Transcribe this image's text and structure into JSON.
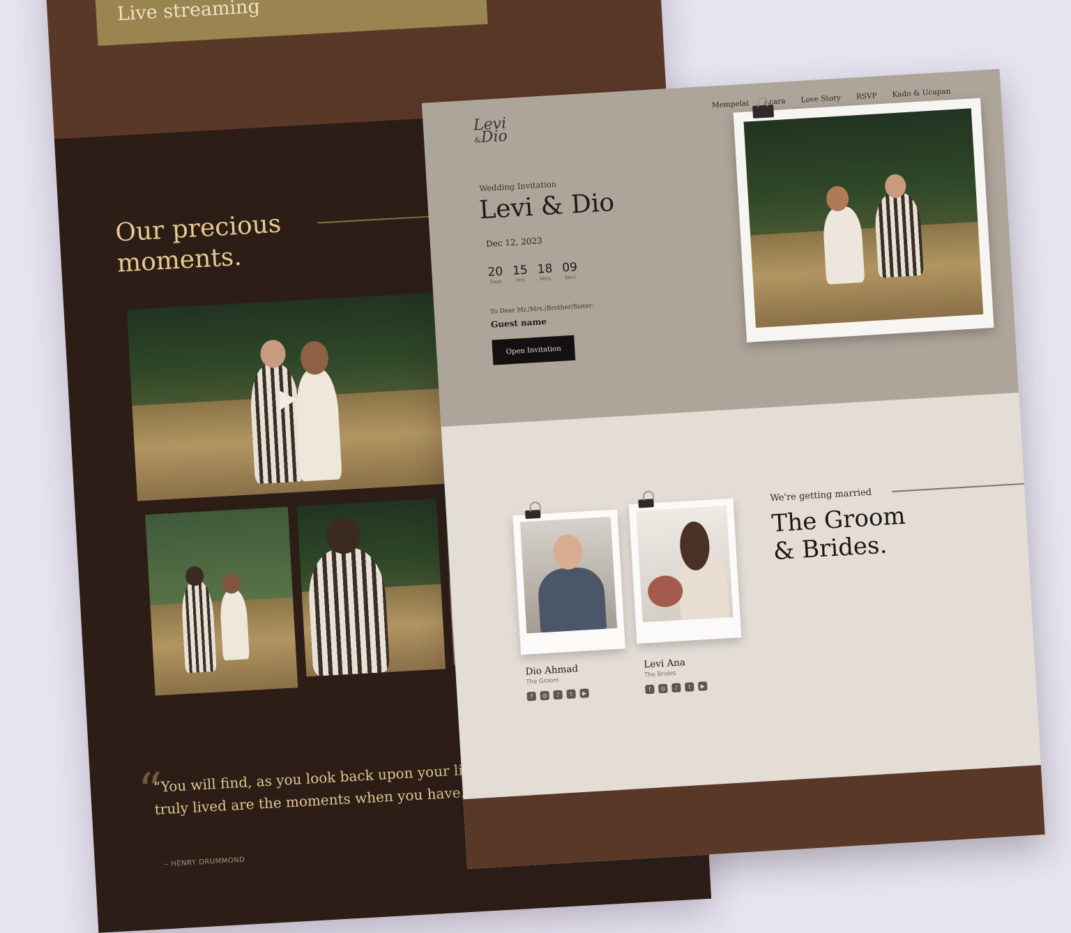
{
  "back_page": {
    "live_streaming_label": "Live streaming",
    "moments_title_line1": "Our precious",
    "moments_title_line2": "moments.",
    "quote_text": "“You will find, as you look back upon your life, that the moments that stand out, the moments when you have truly lived are the moments when you have done things in a spirit of love.”",
    "quote_visible": "“You will find, as you look back upon your life, that th… you have truly lived are the moments when you have… spirit of love.”",
    "quote_author": "– HENRY DRUMMOND"
  },
  "front_page": {
    "logo_line1": "Levi",
    "logo_amp": "&",
    "logo_line2": "Dio",
    "nav": [
      "Mempelai",
      "Acara",
      "Love Story",
      "RSVP",
      "Kado & Ucapan"
    ],
    "subtitle": "Wedding Invitation",
    "couple_names": "Levi & Dio",
    "date": "Dec 12, 2023",
    "countdown": [
      {
        "value": "20",
        "label": "Days"
      },
      {
        "value": "15",
        "label": "Hrs"
      },
      {
        "value": "18",
        "label": "Mins"
      },
      {
        "value": "09",
        "label": "Secs"
      }
    ],
    "to_dear": "To Dear Mr./Mrs./Brother/Sister:",
    "guest_name": "Guest name",
    "open_invitation_label": "Open Invitation",
    "getting_married": "We're getting married",
    "groom_brides_line1": "The Groom",
    "groom_brides_line2": "& Brides.",
    "groom": {
      "name": "Dio Ahmad",
      "role": "The Groom"
    },
    "bride": {
      "name": "Levi Ana",
      "role": "The Brides"
    },
    "social_icons": [
      "facebook-icon",
      "instagram-icon",
      "tiktok-icon",
      "twitter-icon",
      "youtube-icon"
    ]
  },
  "colors": {
    "background": "#e6e4f1",
    "dark_brown": "#2c1d17",
    "brown": "#5a3828",
    "gold": "#9a8450",
    "gold_text": "#e7c98f",
    "hero_taupe": "#aea59a",
    "paper": "#e4ddd6"
  }
}
